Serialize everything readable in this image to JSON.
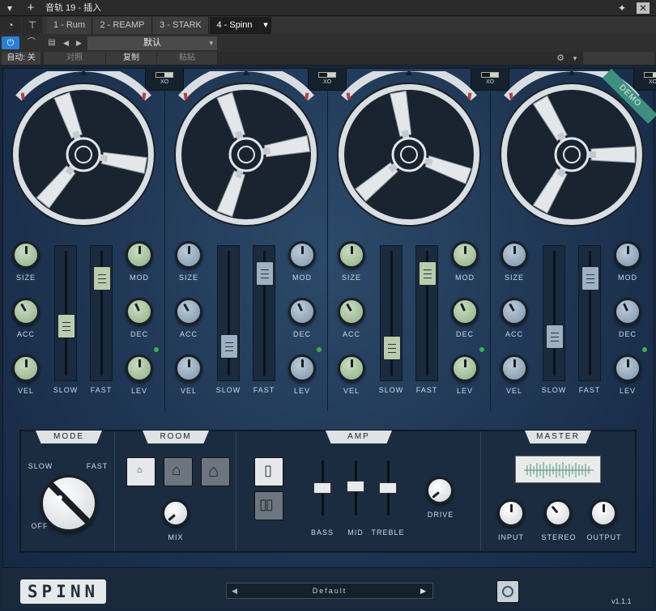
{
  "host": {
    "track_title": "音轨 19 - 插入",
    "tabs": [
      {
        "label": "1 - Rum"
      },
      {
        "label": "2 - REAMP"
      },
      {
        "label": "3 - STARK"
      },
      {
        "label": "4 - Spinn"
      }
    ],
    "preset_name": "默认",
    "auto_label": "自动: 关",
    "compare_label": "对照",
    "copy_label": "复制",
    "paste_label": "粘贴"
  },
  "plugin": {
    "demo_badge": "DEMO",
    "xo_label": "XO",
    "channels": [
      {
        "knobs": {
          "size": "green",
          "acc": "green",
          "vel": "green",
          "mod": "green",
          "dec": "green",
          "lev": "green"
        },
        "slow_pos": 0.38,
        "fast_pos": 0.85,
        "lev_led": true
      },
      {
        "knobs": {
          "size": "blue",
          "acc": "blue",
          "vel": "blue",
          "mod": "blue",
          "dec": "blue",
          "lev": "blue"
        },
        "slow_pos": 0.18,
        "fast_pos": 0.9,
        "lev_led": true
      },
      {
        "knobs": {
          "size": "green",
          "acc": "green",
          "vel": "green",
          "mod": "green",
          "dec": "green",
          "lev": "green"
        },
        "slow_pos": 0.17,
        "fast_pos": 0.9,
        "lev_led": true
      },
      {
        "knobs": {
          "size": "blue",
          "acc": "blue",
          "vel": "blue",
          "mod": "blue",
          "dec": "blue",
          "lev": "blue"
        },
        "slow_pos": 0.28,
        "fast_pos": 0.85,
        "lev_led": true
      }
    ],
    "labels": {
      "size": "SIZE",
      "acc": "ACC",
      "vel": "VEL",
      "slow": "SLOW",
      "fast": "FAST",
      "mod": "MOD",
      "dec": "DEC",
      "lev": "LEV"
    },
    "mode": {
      "title": "MODE",
      "slow": "SLOW",
      "fast": "FAST",
      "off": "OFF"
    },
    "room": {
      "title": "ROOM",
      "mix": "MIX"
    },
    "amp": {
      "title": "AMP",
      "bass": "BASS",
      "mid": "MID",
      "treble": "TREBLE",
      "drive": "DRIVE"
    },
    "master": {
      "title": "MASTER",
      "input": "INPUT",
      "stereo": "STEREO",
      "output": "OUTPUT"
    },
    "footer": {
      "logo": "SPINN",
      "preset": "Default",
      "version": "v1.1.1"
    },
    "colors": {
      "green_knob": "#a9c4a1",
      "blue_knob": "#9cb1c5",
      "led": "#3fae56",
      "demo": "#3f8f7f"
    }
  }
}
